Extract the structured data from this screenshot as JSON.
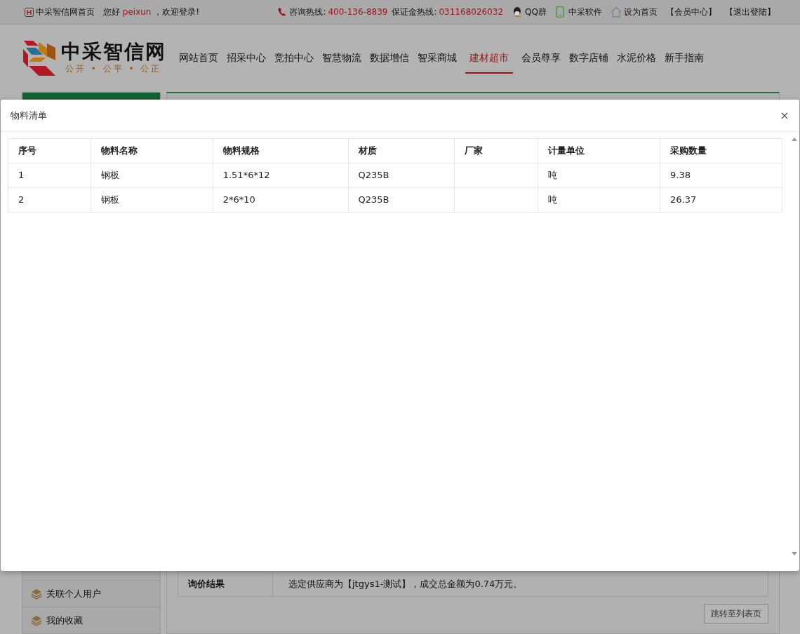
{
  "topbar": {
    "home_link": "中采智信网首页",
    "greeting": {
      "prefix": "您好",
      "user": "peixun",
      "suffix": "，欢迎登录!"
    },
    "hotlines": [
      {
        "label": "咨询热线:",
        "number": "400-136-8839",
        "kind": "phone"
      },
      {
        "label": "保证金热线:",
        "number": "031168026032",
        "kind": "plain"
      }
    ],
    "links": [
      {
        "label": "QQ群",
        "kind": "qq"
      },
      {
        "label": "中采软件",
        "kind": "mobile"
      },
      {
        "label": "设为首页",
        "kind": "home"
      },
      {
        "label": "【会员中心】",
        "kind": "plain"
      },
      {
        "label": "【退出登陆】",
        "kind": "plain"
      }
    ]
  },
  "logo": {
    "name": "中采智信网",
    "slogan": "公开 • 公平 • 公正"
  },
  "nav": [
    {
      "label": "网站首页",
      "selected": false
    },
    {
      "label": "招采中心",
      "selected": false
    },
    {
      "label": "竞拍中心",
      "selected": false
    },
    {
      "label": "智慧物流",
      "selected": false
    },
    {
      "label": "数据增信",
      "selected": false
    },
    {
      "label": "智采商城",
      "selected": false
    },
    {
      "label": "建材超市",
      "selected": true
    },
    {
      "label": "会员尊享",
      "selected": false
    },
    {
      "label": "数字店铺",
      "selected": false
    },
    {
      "label": "水泥价格",
      "selected": false
    },
    {
      "label": "新手指南",
      "selected": false
    }
  ],
  "sidebar": {
    "items": [
      {
        "label": "关联个人用户"
      },
      {
        "label": "我的收藏"
      }
    ]
  },
  "result": {
    "label": "询价结果",
    "value": "选定供应商为【jtgys1-测试】，成交总金额为0.74万元。"
  },
  "list_button": "跳转至列表页",
  "modal": {
    "title": "物料清单",
    "table": {
      "columns": [
        "序号",
        "物料名称",
        "物料规格",
        "材质",
        "厂家",
        "计量单位",
        "采购数量"
      ],
      "rows": [
        [
          "1",
          "钢板",
          "1.51*6*12",
          "Q235B",
          "",
          "吨",
          "9.38"
        ],
        [
          "2",
          "钢板",
          "2*6*10",
          "Q235B",
          "",
          "吨",
          "26.37"
        ]
      ]
    }
  }
}
